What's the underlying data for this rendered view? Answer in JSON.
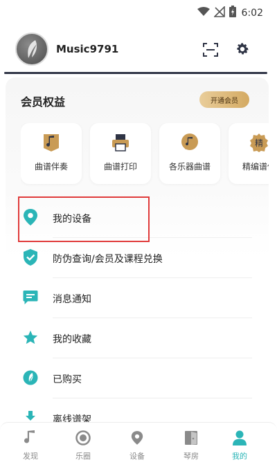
{
  "status_bar": {
    "time": "6:02"
  },
  "profile": {
    "username": "Music9791"
  },
  "vip": {
    "title": "会员权益",
    "open_button": "开通会员",
    "benefits": [
      {
        "label": "曲谱伴奏",
        "icon": "music-note-icon"
      },
      {
        "label": "曲谱打印",
        "icon": "printer-icon"
      },
      {
        "label": "各乐器曲谱",
        "icon": "instrument-score-icon"
      },
      {
        "label": "精编谱仿",
        "icon": "jing-badge-icon",
        "badge": "精"
      }
    ]
  },
  "menu": [
    {
      "label": "我的设备",
      "icon": "location-pin-icon"
    },
    {
      "label": "防伪查询/会员及课程兑换",
      "icon": "shield-check-icon"
    },
    {
      "label": "消息通知",
      "icon": "message-icon"
    },
    {
      "label": "我的收藏",
      "icon": "star-icon"
    },
    {
      "label": "已购买",
      "icon": "purchased-icon"
    },
    {
      "label": "离线谱架",
      "icon": "download-icon"
    }
  ],
  "bottom_nav": [
    {
      "label": "发现",
      "icon": "music-note-icon",
      "active": false
    },
    {
      "label": "乐圈",
      "icon": "circle-target-icon",
      "active": false
    },
    {
      "label": "设备",
      "icon": "location-pin-icon",
      "active": false
    },
    {
      "label": "琴房",
      "icon": "door-icon",
      "active": false
    },
    {
      "label": "我的",
      "icon": "person-icon",
      "active": true
    }
  ],
  "colors": {
    "accent": "#2bb5b7",
    "gold": "#d4aa62",
    "highlight": "#e03a3a",
    "dark_icon": "#2f3445"
  }
}
